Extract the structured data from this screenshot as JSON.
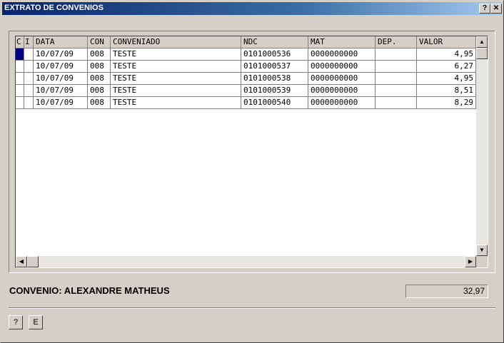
{
  "window": {
    "title": "EXTRATO DE CONVENIOS",
    "help_button_label": "?",
    "close_button_label": "✕"
  },
  "grid": {
    "columns": [
      "C",
      "I",
      "DATA",
      "CON",
      "CONVENIADO",
      "NDC",
      "MAT",
      "DEP.",
      "VALOR"
    ],
    "rows": [
      {
        "c": "",
        "i": "",
        "data": "10/07/09",
        "con": "008",
        "conveniado": "TESTE",
        "ndc": "0101000536",
        "mat": "0000000000",
        "dep": "",
        "valor": "4,95"
      },
      {
        "c": "",
        "i": "",
        "data": "10/07/09",
        "con": "008",
        "conveniado": "TESTE",
        "ndc": "0101000537",
        "mat": "0000000000",
        "dep": "",
        "valor": "6,27"
      },
      {
        "c": "",
        "i": "",
        "data": "10/07/09",
        "con": "008",
        "conveniado": "TESTE",
        "ndc": "0101000538",
        "mat": "0000000000",
        "dep": "",
        "valor": "4,95"
      },
      {
        "c": "",
        "i": "",
        "data": "10/07/09",
        "con": "008",
        "conveniado": "TESTE",
        "ndc": "0101000539",
        "mat": "0000000000",
        "dep": "",
        "valor": "8,51"
      },
      {
        "c": "",
        "i": "",
        "data": "10/07/09",
        "con": "008",
        "conveniado": "TESTE",
        "ndc": "0101000540",
        "mat": "0000000000",
        "dep": "",
        "valor": "8,29"
      }
    ],
    "selected_row": 0,
    "selection_color": "#000080"
  },
  "footer": {
    "convenio_label": "CONVENIO: ALEXANDRE MATHEUS",
    "total": "32,97",
    "help_button_label": "?",
    "e_button_label": "E"
  },
  "colors": {
    "window_bg": "#d4d0c8",
    "titlebar_start": "#0a246a",
    "titlebar_end": "#a6caf0"
  }
}
